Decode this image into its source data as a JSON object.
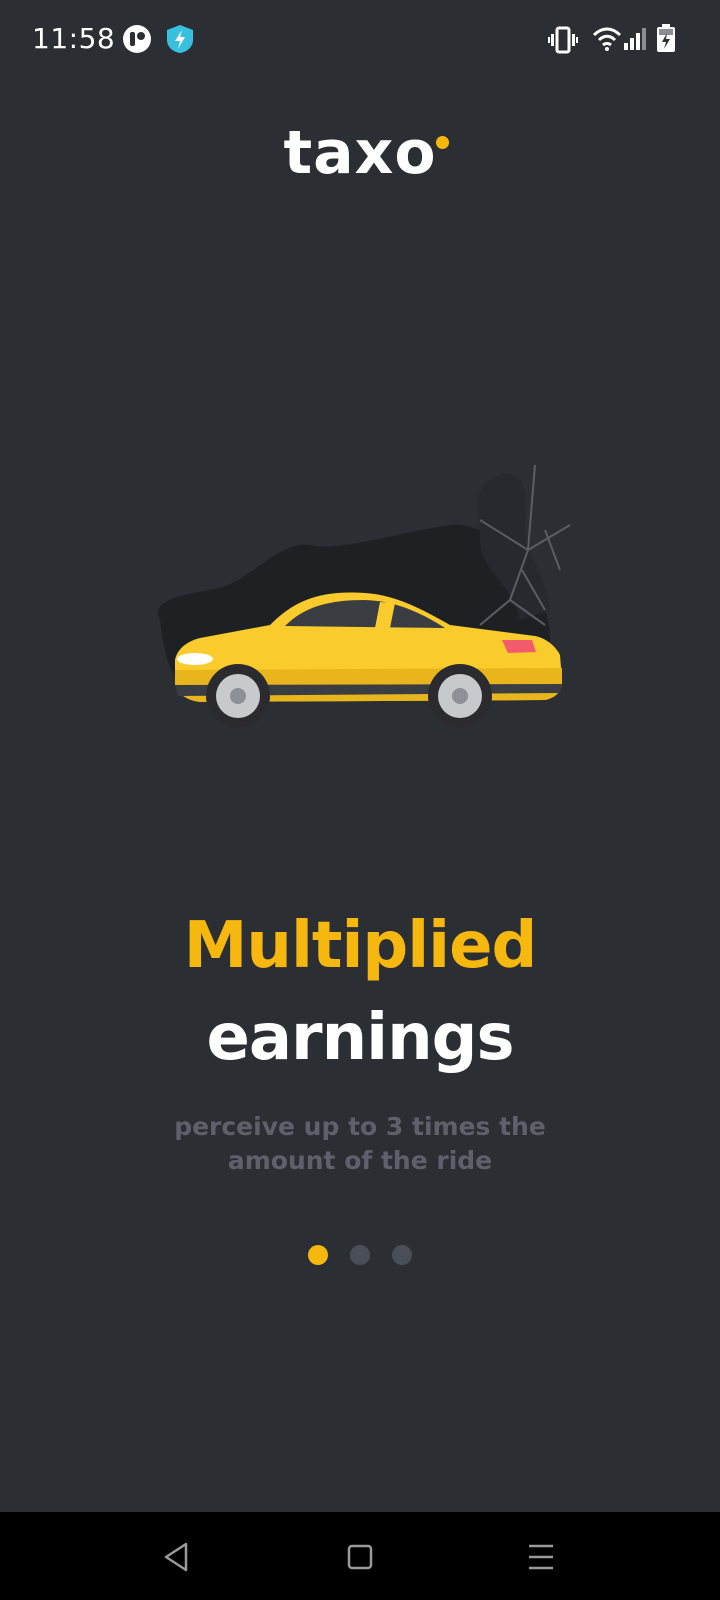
{
  "status_bar": {
    "time": "11:58",
    "left_icons": [
      "app-notification-icon",
      "shield-bolt-icon"
    ],
    "right_icons": [
      "vibrate-icon",
      "wifi-icon",
      "signal-icon",
      "battery-charging-icon"
    ]
  },
  "app": {
    "logo_text": "taxo"
  },
  "onboarding": {
    "headline_accent": "Multiplied",
    "headline_main": "earnings",
    "subtitle": "perceive up to 3 times the amount of the ride",
    "page_count": 3,
    "active_page": 1
  },
  "nav_bar": {
    "buttons": [
      "back-icon",
      "home-icon",
      "menu-icon"
    ]
  },
  "colors": {
    "background": "#2b2f33",
    "accent": "#f6b80e",
    "text_primary": "#ffffff",
    "text_muted": "#5c616b",
    "dot_inactive": "#4a4e57",
    "nav_bar": "#000000"
  }
}
